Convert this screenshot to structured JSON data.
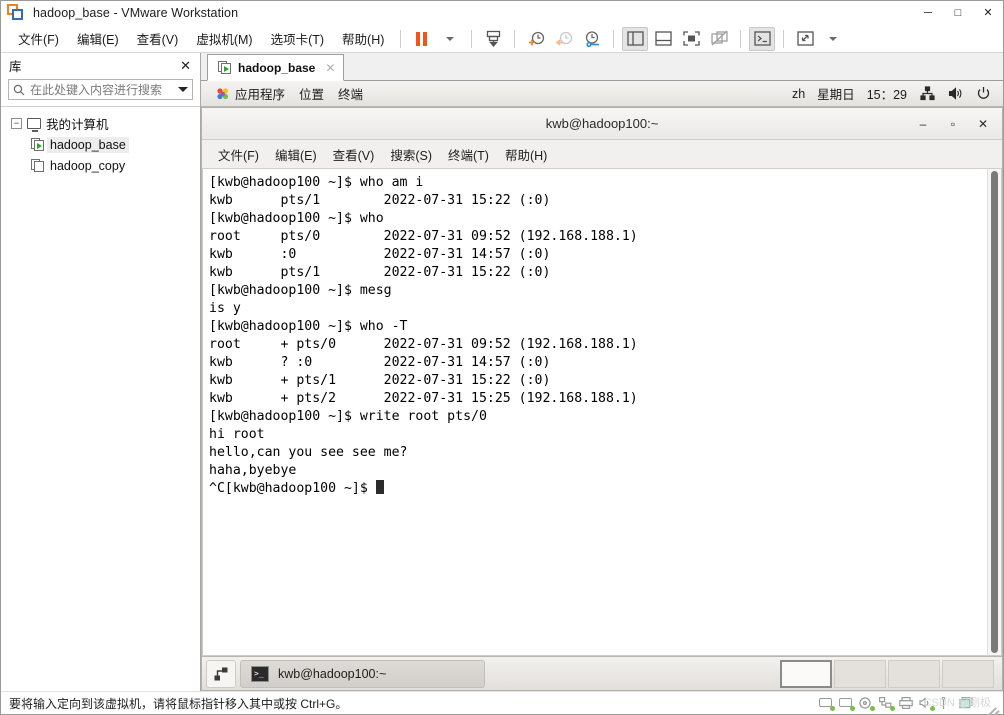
{
  "window": {
    "title": "hadoop_base - VMware Workstation",
    "minimize": "─",
    "maximize": "□",
    "close": "✕"
  },
  "menubar": {
    "items": [
      {
        "label": "文件(F)",
        "name": "menu-file"
      },
      {
        "label": "编辑(E)",
        "name": "menu-edit"
      },
      {
        "label": "查看(V)",
        "name": "menu-view"
      },
      {
        "label": "虚拟机(M)",
        "name": "menu-vm"
      },
      {
        "label": "选项卡(T)",
        "name": "menu-tabs"
      },
      {
        "label": "帮助(H)",
        "name": "menu-help"
      }
    ],
    "toolbar_icons": [
      "pause-icon",
      "dropdown-caret-icon",
      "send-ctrl-alt-del-icon",
      "snapshot-take-icon",
      "snapshot-revert-icon",
      "snapshot-manager-icon",
      "show-library-icon",
      "show-thumbnail-bar-icon",
      "fullscreen-icon",
      "unity-mode-icon",
      "console-view-icon",
      "stretch-icon",
      "stretch-caret-icon"
    ]
  },
  "library": {
    "title": "库",
    "close_label": "✕",
    "search": {
      "placeholder": "在此处键入内容进行搜索",
      "value": ""
    },
    "tree": {
      "root": {
        "label": "我的计算机",
        "expander": "−"
      },
      "items": [
        {
          "label": "hadoop_base",
          "selected": true,
          "state": "running"
        },
        {
          "label": "hadoop_copy",
          "selected": false,
          "state": "stopped"
        }
      ]
    }
  },
  "vm_tab": {
    "label": "hadoop_base",
    "close": "✕"
  },
  "gnome_panel": {
    "applications": "应用程序",
    "places": "位置",
    "terminal": "终端",
    "input_method": "zh",
    "weekday": "星期日",
    "clock": "15：29",
    "tray_icons": [
      "network-icon",
      "volume-icon",
      "power-icon"
    ]
  },
  "terminal": {
    "title": "kwb@hadoop100:~",
    "controls": {
      "minimize": "–",
      "maximize": "▫",
      "close": "✕"
    },
    "menu": [
      "文件(F)",
      "编辑(E)",
      "查看(V)",
      "搜索(S)",
      "终端(T)",
      "帮助(H)"
    ],
    "lines": [
      "[kwb@hadoop100 ~]$ who am i",
      "kwb      pts/1        2022-07-31 15:22 (:0)",
      "[kwb@hadoop100 ~]$ who",
      "root     pts/0        2022-07-31 09:52 (192.168.188.1)",
      "kwb      :0           2022-07-31 14:57 (:0)",
      "kwb      pts/1        2022-07-31 15:22 (:0)",
      "[kwb@hadoop100 ~]$ mesg",
      "is y",
      "[kwb@hadoop100 ~]$ who -T",
      "root     + pts/0      2022-07-31 09:52 (192.168.188.1)",
      "kwb      ? :0         2022-07-31 14:57 (:0)",
      "kwb      + pts/1      2022-07-31 15:22 (:0)",
      "kwb      + pts/2      2022-07-31 15:25 (192.168.188.1)",
      "[kwb@hadoop100 ~]$ write root pts/0",
      "hi root",
      "hello,can you see see me?",
      "haha,byebye"
    ],
    "prompt_line": "^C[kwb@hadoop100 ~]$ "
  },
  "taskbar": {
    "show_desktop": "show-desktop-icon",
    "task_label": "kwb@hadoop100:~",
    "workspaces": [
      {
        "active": true
      },
      {
        "active": false
      },
      {
        "active": false
      },
      {
        "active": false
      }
    ]
  },
  "statusbar": {
    "hint": "要将输入定向到该虚拟机，请将鼠标指针移入其中或按 Ctrl+G。",
    "device_icons": [
      "hard-disk-icon",
      "hard-disk-icon",
      "cd-dvd-icon",
      "network-adapter-icon",
      "printer-icon",
      "sound-card-icon",
      "usb-icon",
      "display-icon"
    ],
    "watermark": "CSDN @刚极"
  },
  "colors": {
    "accent_orange": "#f1801d",
    "accent_blue": "#2f6eb5",
    "vm_running_green": "#2aa52a",
    "status_green": "#76c043",
    "terminal_bg": "#ffffff",
    "terminal_fg": "#000000"
  }
}
